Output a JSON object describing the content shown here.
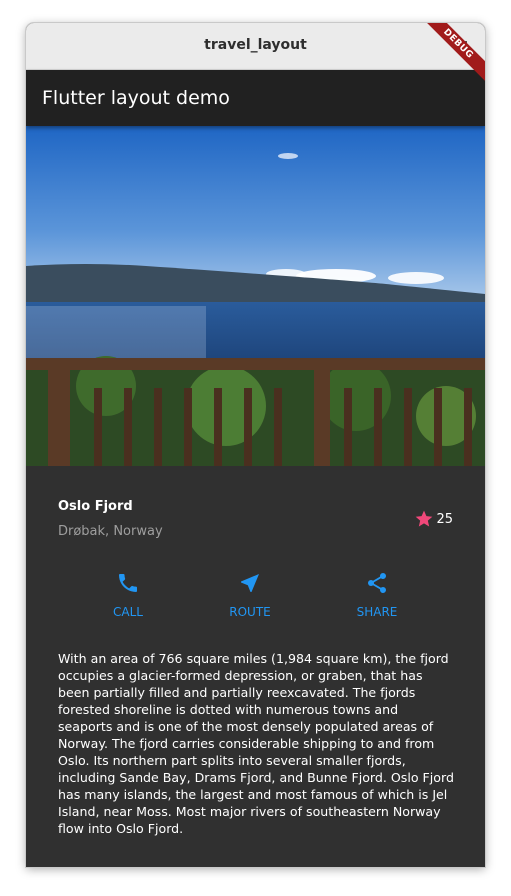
{
  "window": {
    "title": "travel_layout"
  },
  "appbar": {
    "title": "Flutter layout demo",
    "debug_banner": "DEBUG"
  },
  "place": {
    "name": "Oslo Fjord",
    "location": "Drøbak, Norway",
    "rating": "25"
  },
  "actions": [
    {
      "icon": "phone-icon",
      "label": "CALL"
    },
    {
      "icon": "navigation-icon",
      "label": "ROUTE"
    },
    {
      "icon": "share-icon",
      "label": "SHARE"
    }
  ],
  "description": "With an area of 766 square miles (1,984 square km), the fjord occupies a glacier-formed depression, or graben, that has been partially filled and partially reexcavated. The fjords forested shoreline is dotted with numerous towns and seaports and is one of the most densely populated areas of Norway. The fjord carries considerable shipping to and from Oslo. Its northern part splits into several smaller fjords, including Sande Bay, Drams Fjord, and Bunne Fjord. Oslo Fjord has many islands, the largest and most famous of which is Jel Island, near Moss. Most major rivers of southeastern Norway flow into Oslo Fjord.",
  "colors": {
    "accent": "#2196f3",
    "star": "#f0487a",
    "background": "#303030",
    "appbar": "#212121"
  }
}
